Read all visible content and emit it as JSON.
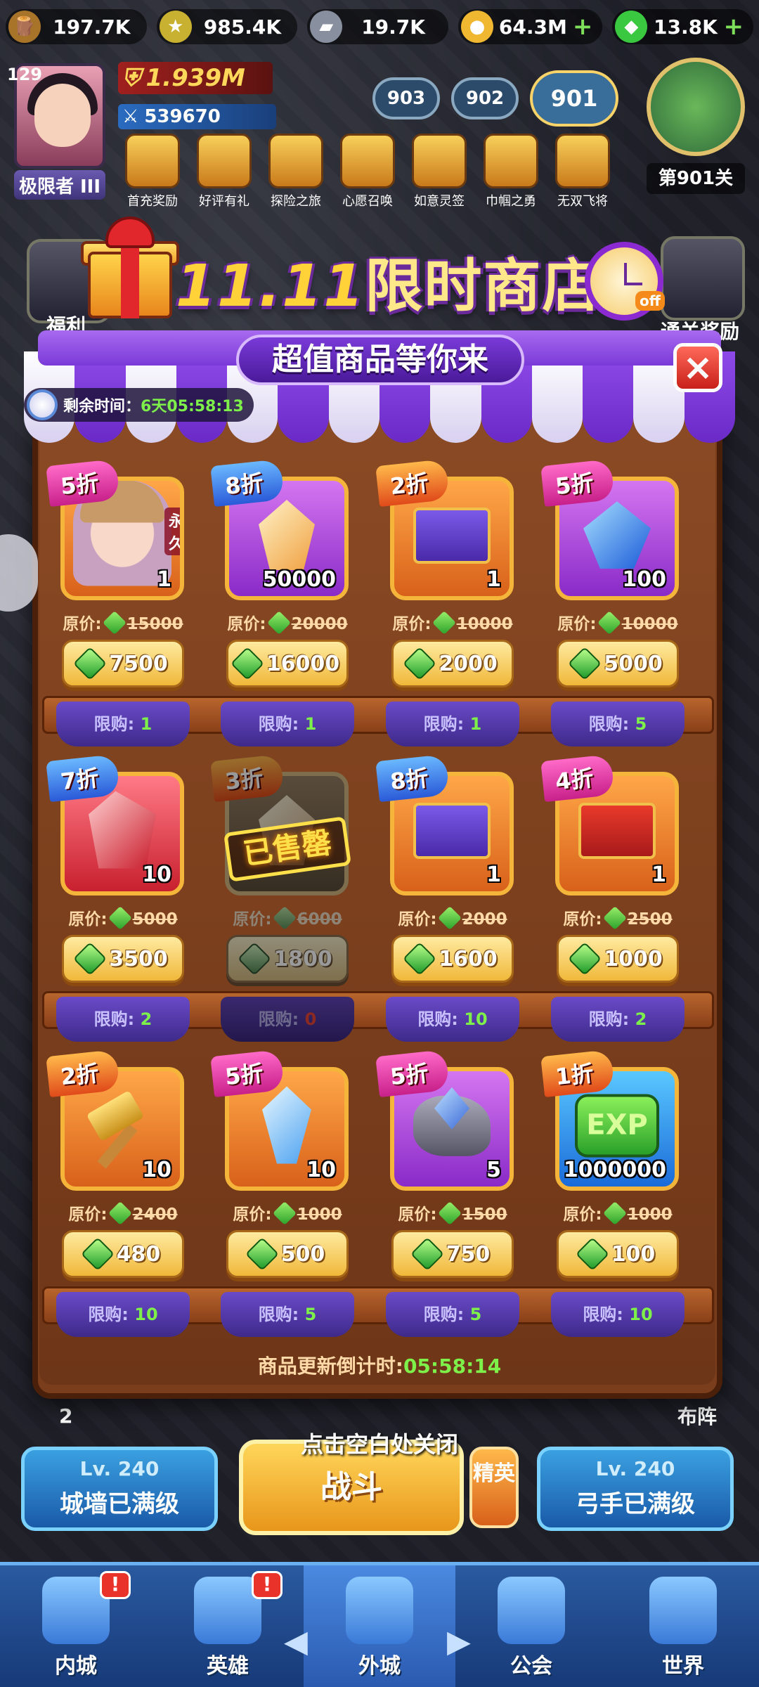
{
  "topbar": {
    "resources": [
      {
        "icon": "wood-icon",
        "value": "197.7K",
        "plus": false,
        "color": "#a8742a"
      },
      {
        "icon": "star-medal-icon",
        "value": "985.4K",
        "plus": false,
        "color": "#c8b030"
      },
      {
        "icon": "iron-icon",
        "value": "19.7K",
        "plus": false,
        "color": "#8890a0"
      },
      {
        "icon": "gold-coin-icon",
        "value": "64.3M",
        "plus": true,
        "color": "#f0b830"
      },
      {
        "icon": "green-gem-icon",
        "value": "13.8K",
        "plus": true,
        "color": "#3ac840"
      }
    ],
    "plus_symbol": "+"
  },
  "player": {
    "level": "129",
    "rank": "极限者 III",
    "power": "1.939M",
    "combat": "539670"
  },
  "events": [
    "首充奖励",
    "好评有礼",
    "探险之旅",
    "心愿召唤",
    "如意灵签",
    "巾帼之勇",
    "无双飞将"
  ],
  "stages": {
    "s1": "903",
    "s2": "902",
    "current": "901",
    "label": "第901关"
  },
  "side": {
    "welfare": "福利",
    "clear_reward": "通关奖励",
    "formation": "布阵",
    "badge2": "2"
  },
  "banner": {
    "title_num": "11.11",
    "title_text": "限时商店",
    "subtitle": "超值商品等你来",
    "off": "off"
  },
  "timer": {
    "label": "剩余时间：",
    "value": "6天05:58:13"
  },
  "close": "×",
  "shop": {
    "orig_label": "原价:",
    "limit_label": "限购: ",
    "sold_label": "已售罄",
    "items": [
      {
        "tag": "5折",
        "perm": "永久",
        "qty": "1",
        "orig": "15000",
        "price": "7500",
        "limit": "1"
      },
      {
        "tag": "8折",
        "qty": "50000",
        "orig": "20000",
        "price": "16000",
        "limit": "1"
      },
      {
        "tag": "2折",
        "qty": "1",
        "orig": "10000",
        "price": "2000",
        "limit": "1"
      },
      {
        "tag": "5折",
        "qty": "100",
        "orig": "10000",
        "price": "5000",
        "limit": "5"
      },
      {
        "tag": "7折",
        "qty": "10",
        "orig": "5000",
        "price": "3500",
        "limit": "2"
      },
      {
        "tag": "3折",
        "qty": "",
        "orig": "6000",
        "price": "1800",
        "limit": "0"
      },
      {
        "tag": "8折",
        "qty": "1",
        "orig": "2000",
        "price": "1600",
        "limit": "10"
      },
      {
        "tag": "4折",
        "qty": "1",
        "orig": "2500",
        "price": "1000",
        "limit": "2"
      },
      {
        "tag": "2折",
        "qty": "10",
        "orig": "2400",
        "price": "480",
        "limit": "10"
      },
      {
        "tag": "5折",
        "qty": "10",
        "orig": "1000",
        "price": "500",
        "limit": "5"
      },
      {
        "tag": "5折",
        "qty": "5",
        "orig": "1500",
        "price": "750",
        "limit": "5"
      },
      {
        "tag": "1折",
        "qty": "1000000",
        "orig": "1000",
        "price": "100",
        "limit": "10"
      }
    ],
    "exp_text": "EXP",
    "refresh_label": "商品更新倒计时:",
    "refresh_value": "05:58:14"
  },
  "close_hint": "点击空白处关闭",
  "bottom": {
    "wall_lv": "Lv. 240",
    "wall_status": "城墙已满级",
    "battle": "战斗",
    "elite": "精英",
    "archer_lv": "Lv. 240",
    "archer_status": "弓手已满级"
  },
  "nav": {
    "items": [
      "内城",
      "英雄",
      "外城",
      "公会",
      "世界"
    ],
    "badge": "!"
  }
}
